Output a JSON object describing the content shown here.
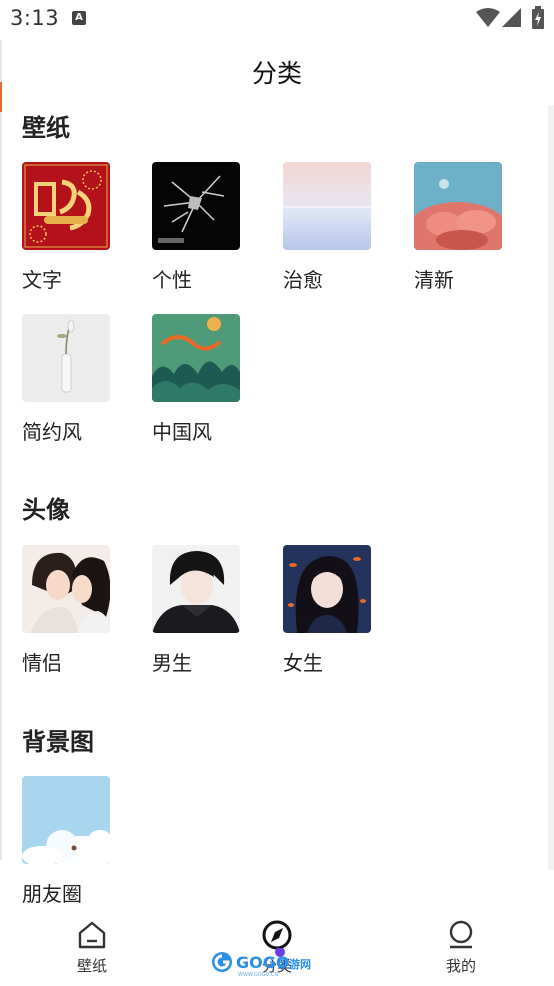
{
  "status_bar": {
    "time": "3:13",
    "notification_icon": "A",
    "icons": [
      "wifi-icon",
      "signal-icon",
      "battery-icon"
    ]
  },
  "header": {
    "title": "分类"
  },
  "sections": [
    {
      "title": "壁纸",
      "items": [
        {
          "label": "文字",
          "thumb": "red-new-year-calligraphy"
        },
        {
          "label": "个性",
          "thumb": "black-shattered-glass"
        },
        {
          "label": "治愈",
          "thumb": "pastel-sky-reflection"
        },
        {
          "label": "清新",
          "thumb": "pink-blossom-blue-sky"
        },
        {
          "label": "简约风",
          "thumb": "white-vase-flower"
        },
        {
          "label": "中国风",
          "thumb": "green-chinese-mountains"
        }
      ]
    },
    {
      "title": "头像",
      "items": [
        {
          "label": "情侣",
          "thumb": "couple-anime"
        },
        {
          "label": "男生",
          "thumb": "boy-anime"
        },
        {
          "label": "女生",
          "thumb": "girl-anime-goldfish"
        }
      ]
    },
    {
      "title": "背景图",
      "items": [
        {
          "label": "朋友圈",
          "thumb": "clouds-sky"
        }
      ]
    }
  ],
  "bottom_nav": {
    "items": [
      {
        "label": "壁纸",
        "icon": "home-icon",
        "active": false
      },
      {
        "label": "分类",
        "icon": "compass-icon",
        "active": true
      },
      {
        "label": "我的",
        "icon": "profile-icon",
        "active": false
      }
    ]
  },
  "watermark": {
    "text": "GOGO",
    "suffix": "手游网",
    "url": "WWW.GOGO.CN"
  },
  "colors": {
    "accent": "#e86a2a",
    "text": "#222222",
    "nav_active": "#6a3fe0"
  }
}
